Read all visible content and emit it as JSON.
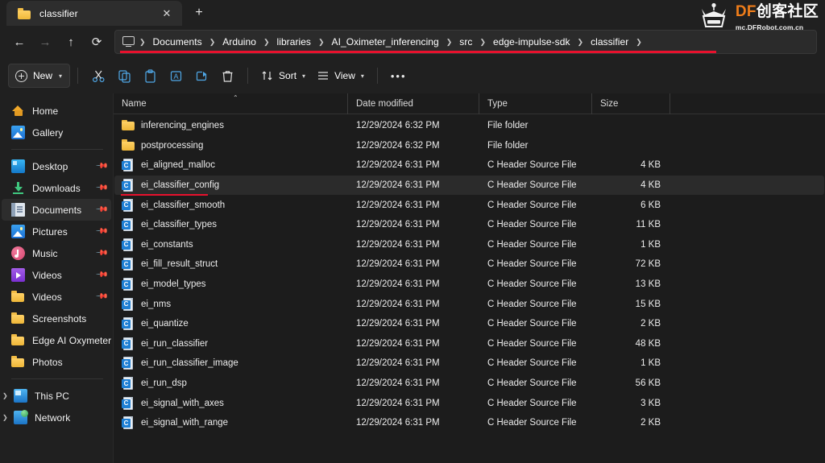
{
  "window": {
    "tab": {
      "title": "classifier",
      "folder_icon": "folder-icon",
      "close_icon": "✕",
      "newtab_icon": "+"
    }
  },
  "nav": {
    "back": "←",
    "forward": "→",
    "up": "↑",
    "refresh": "⟳"
  },
  "address": {
    "root_icon": "this-pc-icon",
    "separator": "❯",
    "crumbs": [
      "Documents",
      "Arduino",
      "libraries",
      "AI_Oximeter_inferencing",
      "src",
      "edge-impulse-sdk",
      "classifier"
    ],
    "underline_color": "#e8112d"
  },
  "toolbar": {
    "new_label": "New",
    "new_chevron": "⌄",
    "cut_label": "cut-icon",
    "copy_label": "copy-icon",
    "paste_label": "paste-icon",
    "rename_label": "rename-icon",
    "share_label": "share-icon",
    "delete_label": "delete-icon",
    "sort_label": "Sort",
    "view_label": "View",
    "more_label": "•••"
  },
  "sidebar": {
    "items": [
      {
        "label": "Home",
        "icon": "home-icon",
        "pinned": false,
        "active": false,
        "expandable": false
      },
      {
        "label": "Gallery",
        "icon": "gallery-icon",
        "pinned": false,
        "active": false,
        "expandable": false
      },
      {
        "label": "Desktop",
        "icon": "desktop-icon",
        "pinned": true,
        "active": false,
        "expandable": false
      },
      {
        "label": "Downloads",
        "icon": "downloads-icon",
        "pinned": true,
        "active": false,
        "expandable": false
      },
      {
        "label": "Documents",
        "icon": "documents-icon",
        "pinned": true,
        "active": true,
        "expandable": false
      },
      {
        "label": "Pictures",
        "icon": "pictures-icon",
        "pinned": true,
        "active": false,
        "expandable": false
      },
      {
        "label": "Music",
        "icon": "music-icon",
        "pinned": true,
        "active": false,
        "expandable": false
      },
      {
        "label": "Videos",
        "icon": "videos-icon",
        "pinned": true,
        "active": false,
        "expandable": false
      },
      {
        "label": "Videos",
        "icon": "folder-icon",
        "pinned": true,
        "active": false,
        "expandable": false
      },
      {
        "label": "Screenshots",
        "icon": "folder-icon",
        "pinned": false,
        "active": false,
        "expandable": false
      },
      {
        "label": "Edge AI Oxymeter",
        "icon": "folder-icon",
        "pinned": false,
        "active": false,
        "expandable": false
      },
      {
        "label": "Photos",
        "icon": "folder-icon",
        "pinned": false,
        "active": false,
        "expandable": false
      },
      {
        "label": "This PC",
        "icon": "this-pc-icon",
        "pinned": false,
        "active": false,
        "expandable": true
      },
      {
        "label": "Network",
        "icon": "network-icon",
        "pinned": false,
        "active": false,
        "expandable": true
      }
    ],
    "pin_glyph": "📌",
    "chevron_glyph": "❯"
  },
  "filelist": {
    "columns": [
      "Name",
      "Date modified",
      "Type",
      "Size"
    ],
    "sort_caret": "⌃",
    "rows": [
      {
        "name": "inferencing_engines",
        "date": "12/29/2024 6:32 PM",
        "type": "File folder",
        "size": "",
        "icon": "folder-icon",
        "selected": false,
        "underlined": false
      },
      {
        "name": "postprocessing",
        "date": "12/29/2024 6:32 PM",
        "type": "File folder",
        "size": "",
        "icon": "folder-icon",
        "selected": false,
        "underlined": false
      },
      {
        "name": "ei_aligned_malloc",
        "date": "12/29/2024 6:31 PM",
        "type": "C Header Source File",
        "size": "4 KB",
        "icon": "c-header-icon",
        "selected": false,
        "underlined": false
      },
      {
        "name": "ei_classifier_config",
        "date": "12/29/2024 6:31 PM",
        "type": "C Header Source File",
        "size": "4 KB",
        "icon": "c-header-icon",
        "selected": true,
        "underlined": true
      },
      {
        "name": "ei_classifier_smooth",
        "date": "12/29/2024 6:31 PM",
        "type": "C Header Source File",
        "size": "6 KB",
        "icon": "c-header-icon",
        "selected": false,
        "underlined": false
      },
      {
        "name": "ei_classifier_types",
        "date": "12/29/2024 6:31 PM",
        "type": "C Header Source File",
        "size": "11 KB",
        "icon": "c-header-icon",
        "selected": false,
        "underlined": false
      },
      {
        "name": "ei_constants",
        "date": "12/29/2024 6:31 PM",
        "type": "C Header Source File",
        "size": "1 KB",
        "icon": "c-header-icon",
        "selected": false,
        "underlined": false
      },
      {
        "name": "ei_fill_result_struct",
        "date": "12/29/2024 6:31 PM",
        "type": "C Header Source File",
        "size": "72 KB",
        "icon": "c-header-icon",
        "selected": false,
        "underlined": false
      },
      {
        "name": "ei_model_types",
        "date": "12/29/2024 6:31 PM",
        "type": "C Header Source File",
        "size": "13 KB",
        "icon": "c-header-icon",
        "selected": false,
        "underlined": false
      },
      {
        "name": "ei_nms",
        "date": "12/29/2024 6:31 PM",
        "type": "C Header Source File",
        "size": "15 KB",
        "icon": "c-header-icon",
        "selected": false,
        "underlined": false
      },
      {
        "name": "ei_quantize",
        "date": "12/29/2024 6:31 PM",
        "type": "C Header Source File",
        "size": "2 KB",
        "icon": "c-header-icon",
        "selected": false,
        "underlined": false
      },
      {
        "name": "ei_run_classifier",
        "date": "12/29/2024 6:31 PM",
        "type": "C Header Source File",
        "size": "48 KB",
        "icon": "c-header-icon",
        "selected": false,
        "underlined": false
      },
      {
        "name": "ei_run_classifier_image",
        "date": "12/29/2024 6:31 PM",
        "type": "C Header Source File",
        "size": "1 KB",
        "icon": "c-header-icon",
        "selected": false,
        "underlined": false
      },
      {
        "name": "ei_run_dsp",
        "date": "12/29/2024 6:31 PM",
        "type": "C Header Source File",
        "size": "56 KB",
        "icon": "c-header-icon",
        "selected": false,
        "underlined": false
      },
      {
        "name": "ei_signal_with_axes",
        "date": "12/29/2024 6:31 PM",
        "type": "C Header Source File",
        "size": "3 KB",
        "icon": "c-header-icon",
        "selected": false,
        "underlined": false
      },
      {
        "name": "ei_signal_with_range",
        "date": "12/29/2024 6:31 PM",
        "type": "C Header Source File",
        "size": "2 KB",
        "icon": "c-header-icon",
        "selected": false,
        "underlined": false
      }
    ],
    "file_icon_letter": "C"
  },
  "watermark": {
    "brand_prefix": "DF",
    "brand_suffix": "创客社区",
    "url": "mc.DFRobot.com.cn",
    "brand_color": "#ef7d1a"
  }
}
